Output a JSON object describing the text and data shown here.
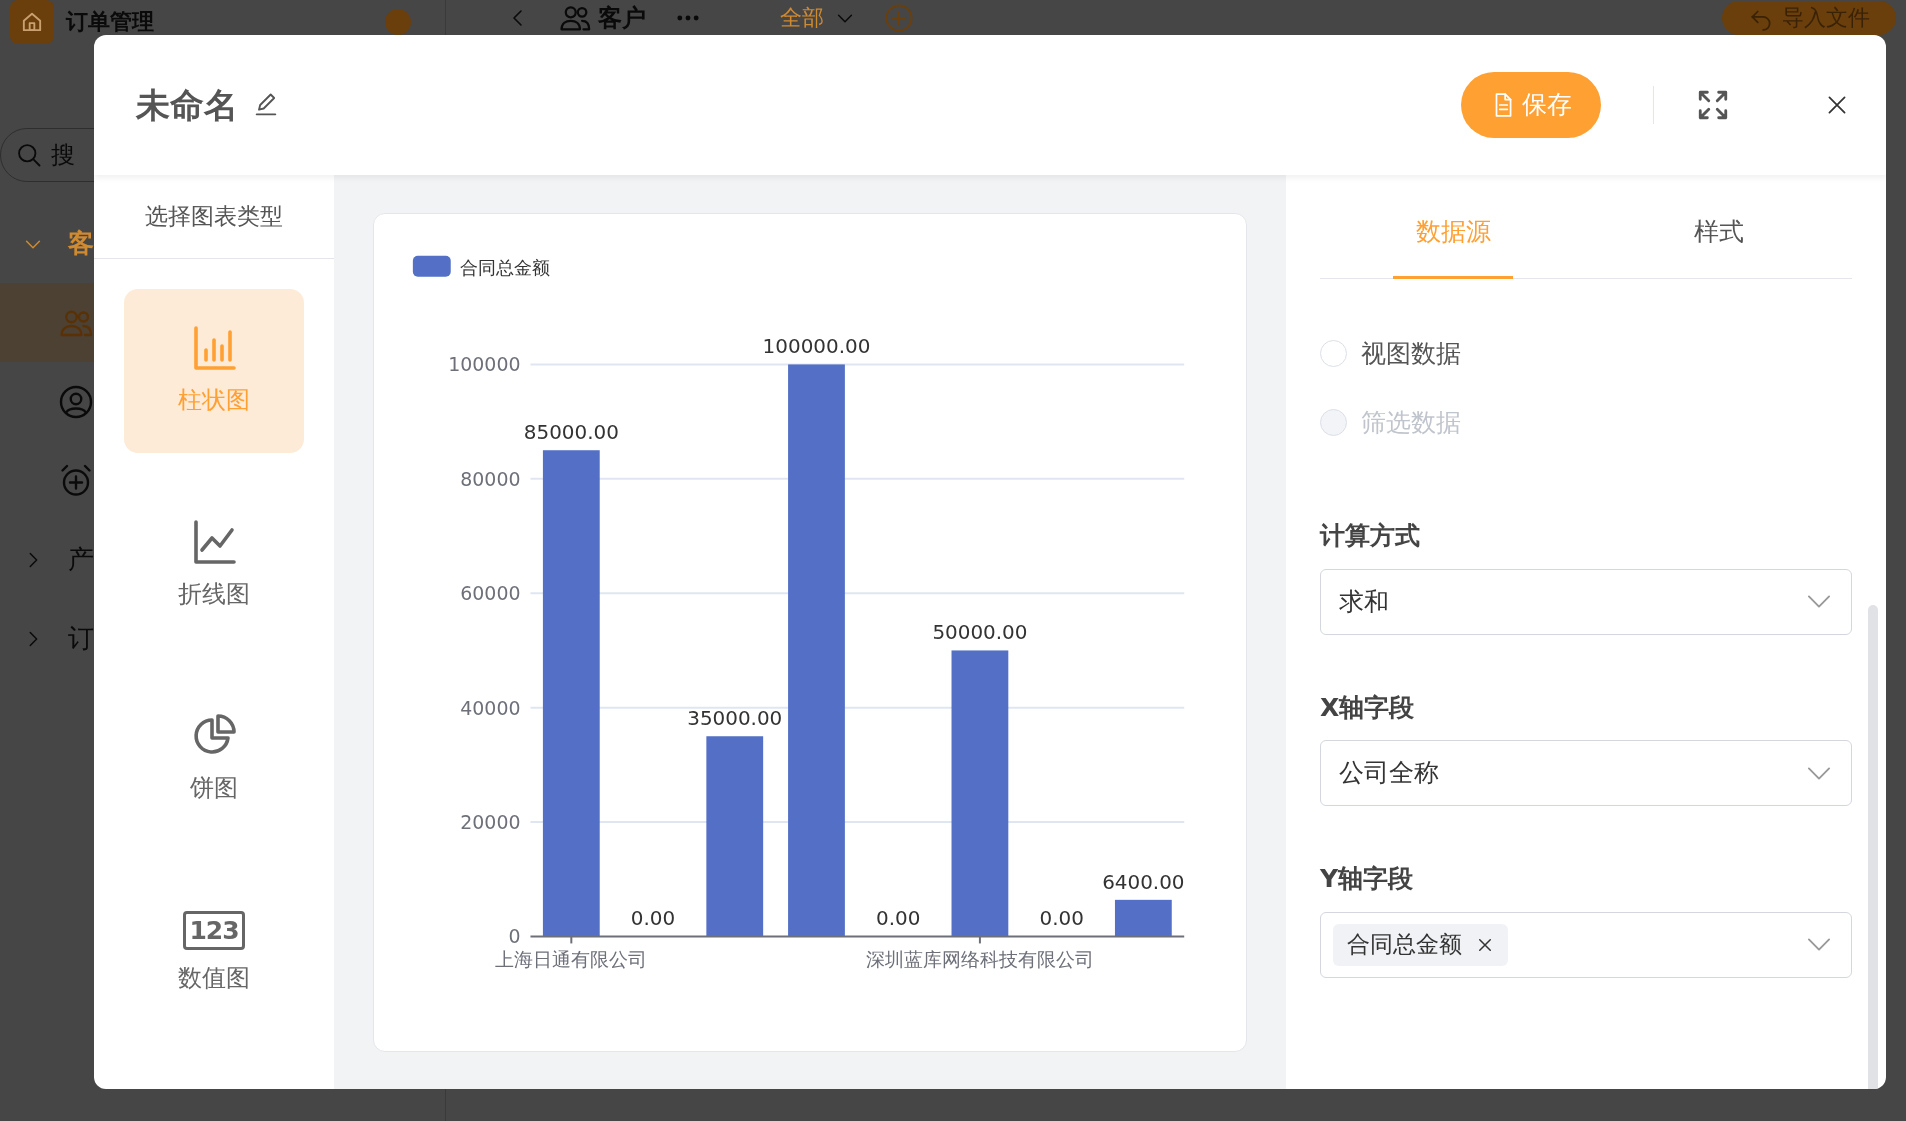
{
  "backdrop": {
    "app_title": "订单管理",
    "search_placeholder": "搜",
    "nav": [
      {
        "label": "客",
        "expanded": true,
        "children": [
          {
            "kind": "people",
            "selected": true
          },
          {
            "kind": "user",
            "selected": false
          },
          {
            "kind": "alarm",
            "selected": false
          }
        ]
      },
      {
        "label": "产",
        "expanded": false
      },
      {
        "label": "订",
        "expanded": false
      }
    ],
    "view_title": "客户",
    "filter": "全部",
    "import_button": "导入文件"
  },
  "title": "未命名",
  "save_button": "保存",
  "chart_types": {
    "heading": "选择图表类型",
    "items": [
      {
        "label": "柱状图",
        "kind": "bar",
        "selected": true
      },
      {
        "label": "折线图",
        "kind": "line",
        "selected": false
      },
      {
        "label": "饼图",
        "kind": "pie",
        "selected": false
      },
      {
        "label": "数值图",
        "kind": "number",
        "icon_text": "123",
        "selected": false
      }
    ]
  },
  "chart": {
    "chart_data": {
      "type": "bar",
      "grid": true,
      "categories": [
        "上海日通有限公司",
        null,
        null,
        null,
        null,
        "深圳蓝库网络科技有限公司",
        null,
        null
      ],
      "series": [
        {
          "name": "合同总金额",
          "color": "#5470c6",
          "values": [
            85000,
            0,
            35000,
            100000,
            0,
            50000,
            0,
            6400
          ]
        }
      ],
      "ylim": [
        0,
        100000
      ],
      "yticks": [
        0,
        20000,
        40000,
        60000,
        80000,
        100000
      ],
      "value_labels": [
        "85000.00",
        "0.00",
        "35000.00",
        "100000.00",
        "0.00",
        "50000.00",
        "0.00",
        "6400.00"
      ]
    }
  },
  "panel": {
    "tabs": [
      {
        "label": "数据源",
        "selected": true
      },
      {
        "label": "样式",
        "selected": false
      }
    ],
    "sources": [
      {
        "label": "视图数据",
        "selected": false,
        "disabled": false
      },
      {
        "label": "筛选数据",
        "selected": false,
        "disabled": true
      }
    ],
    "fields": [
      {
        "label": "计算方式",
        "kind": "select",
        "value": "求和"
      },
      {
        "label": "X轴字段",
        "kind": "select",
        "value": "公司全称"
      },
      {
        "label": "Y轴字段",
        "kind": "tags",
        "tags": [
          "合同总金额"
        ]
      }
    ]
  }
}
